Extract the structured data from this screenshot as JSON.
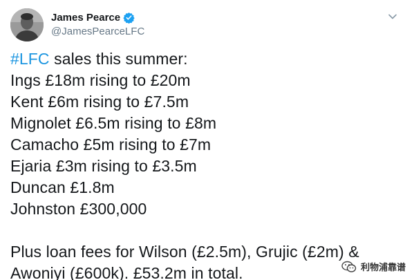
{
  "header": {
    "display_name": "James Pearce",
    "handle": "@JamesPearceLFC"
  },
  "icons": {
    "verified": "verified-badge-icon",
    "caret": "chevron-down-icon",
    "watermark": "wechat-icon"
  },
  "colors": {
    "hashtag": "#1b95e0",
    "verified": "#1da1f2"
  },
  "tweet": {
    "hashtag": "#LFC",
    "intro_rest": " sales this summer:",
    "lines": [
      "Ings £18m rising to £20m",
      "Kent £6m rising to £7.5m",
      "Mignolet £6.5m rising to £8m",
      "Camacho £5m rising to £7m",
      "Ejaria £3m rising to £3.5m",
      "Duncan £1.8m",
      "Johnston £300,000"
    ],
    "footer_lines": [
      "Plus loan fees for Wilson (£2.5m), Grujic (£2m) &",
      "Awoniyi (£600k). £53.2m in total."
    ]
  },
  "watermark": {
    "text": "利物浦靠谱"
  }
}
